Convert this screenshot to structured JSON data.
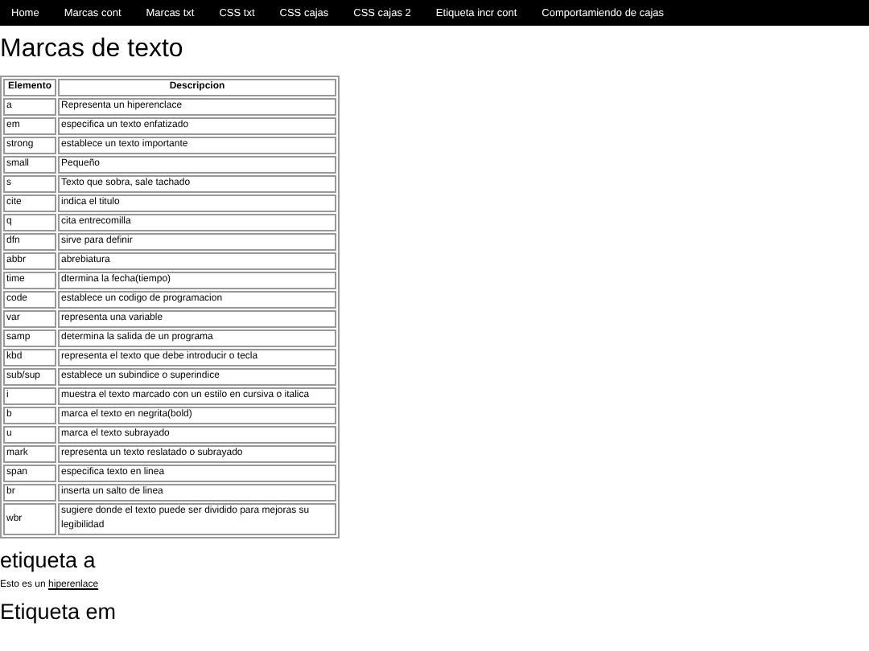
{
  "nav": [
    {
      "label": "Home"
    },
    {
      "label": "Marcas cont"
    },
    {
      "label": "Marcas txt"
    },
    {
      "label": "CSS txt"
    },
    {
      "label": "CSS cajas"
    },
    {
      "label": "CSS cajas 2"
    },
    {
      "label": "Etiqueta incr cont"
    },
    {
      "label": "Comportamiendo de cajas"
    }
  ],
  "title": "Marcas de texto",
  "table": {
    "columns": [
      "Elemento",
      "Descripcion"
    ],
    "rows": [
      [
        "a",
        "Representa un hiperenclace"
      ],
      [
        "em",
        "especifica un texto enfatizado"
      ],
      [
        "strong",
        "establece un texto importante"
      ],
      [
        "small",
        "Pequeño"
      ],
      [
        "s",
        "Texto que sobra, sale tachado"
      ],
      [
        "cite",
        "indica el titulo"
      ],
      [
        "q",
        "cita entrecomilla"
      ],
      [
        "dfn",
        "sirve para definir"
      ],
      [
        "abbr",
        "abrebiatura"
      ],
      [
        "time",
        "dtermina la fecha(tiempo)"
      ],
      [
        "code",
        "establece un codigo de programacion"
      ],
      [
        "var",
        "representa una variable"
      ],
      [
        "samp",
        "determina la salida de un programa"
      ],
      [
        "kbd",
        "representa el texto que debe introducir o tecla"
      ],
      [
        "sub/sup",
        "establece un subindice o superindice"
      ],
      [
        "i",
        "muestra el texto marcado con un estilo en cursiva o italica"
      ],
      [
        "b",
        "marca el texto en negrita(bold)"
      ],
      [
        "u",
        "marca el texto subrayado"
      ],
      [
        "mark",
        "representa un texto reslatado o subrayado"
      ],
      [
        "span",
        "especifica texto en linea"
      ],
      [
        "br",
        "inserta un salto de linea"
      ],
      [
        "wbr",
        "sugiere donde el texto puede ser dividido para mejoras su legibilidad"
      ]
    ]
  },
  "sections": [
    {
      "heading": "etiqueta a",
      "text": "Esto es un ",
      "link": "hiperenlace"
    },
    {
      "heading": "Etiqueta em"
    }
  ]
}
